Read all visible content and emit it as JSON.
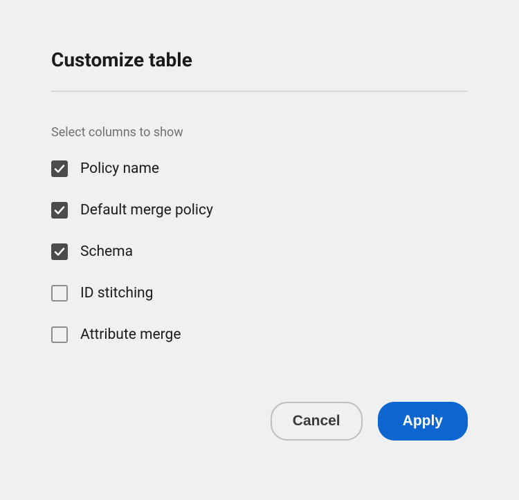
{
  "dialog": {
    "title": "Customize table",
    "section_label": "Select columns to show",
    "columns": [
      {
        "label": "Policy name",
        "checked": true
      },
      {
        "label": "Default merge policy",
        "checked": true
      },
      {
        "label": "Schema",
        "checked": true
      },
      {
        "label": "ID stitching",
        "checked": false
      },
      {
        "label": "Attribute merge",
        "checked": false
      }
    ],
    "cancel_label": "Cancel",
    "apply_label": "Apply"
  }
}
